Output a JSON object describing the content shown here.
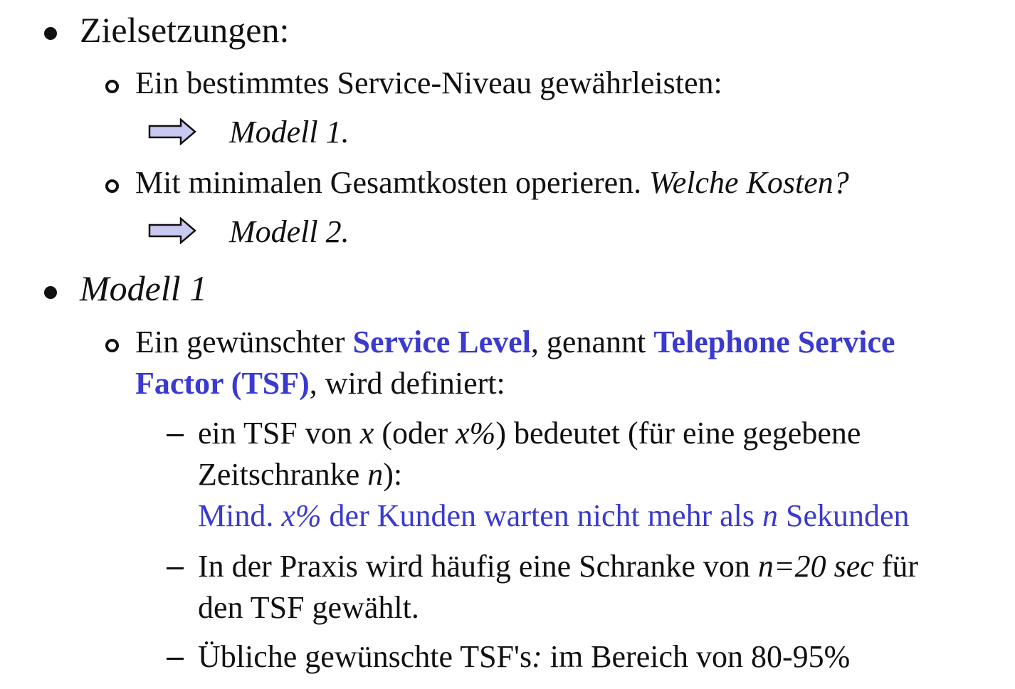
{
  "section1": {
    "heading": "Zielsetzungen:",
    "item1": {
      "text": "Ein bestimmtes Service-Niveau gewährleisten:",
      "result": "Modell 1."
    },
    "item2": {
      "text": "Mit minimalen Gesamtkosten operieren. ",
      "question": "Welche Kosten?",
      "result": "Modell 2."
    }
  },
  "section2": {
    "heading": "Modell 1",
    "item1": {
      "part1": "Ein gewünschter ",
      "term1": "Service Level",
      "part2": ", genannt ",
      "term2a": "Telephone Service",
      "term2b": "Factor (TSF)",
      "part3": ", wird definiert:"
    },
    "sub1": {
      "a1": "ein TSF von ",
      "x1": "x",
      "a2": " (oder ",
      "x2": "x%",
      "a3": ") bedeutet (für eine gegebene",
      "b1": "Zeitschranke ",
      "n1": "n",
      "b2": "):",
      "c1": "Mind. ",
      "x3": "x%",
      "c2": " der Kunden warten nicht mehr als ",
      "n2": "n",
      "c3": " Sekunden"
    },
    "sub2": {
      "a1": "In der Praxis wird häufig eine Schranke von ",
      "nval": "n=20 sec",
      "a2": " für",
      "b1": "den TSF gewählt."
    },
    "sub3": {
      "a1": "Übliche gewünschte TSF's",
      "colon": ":",
      "a2": " im Bereich von 80-95%"
    }
  },
  "colors": {
    "highlight": "#3a3ad0",
    "arrow_fill": "#c8c8f0",
    "text": "#111111"
  },
  "icons": {
    "bullet_level1": "filled-circle-icon",
    "bullet_level2": "hollow-circle-icon",
    "bullet_level3": "dash-icon",
    "result_arrow": "right-arrow-icon"
  }
}
